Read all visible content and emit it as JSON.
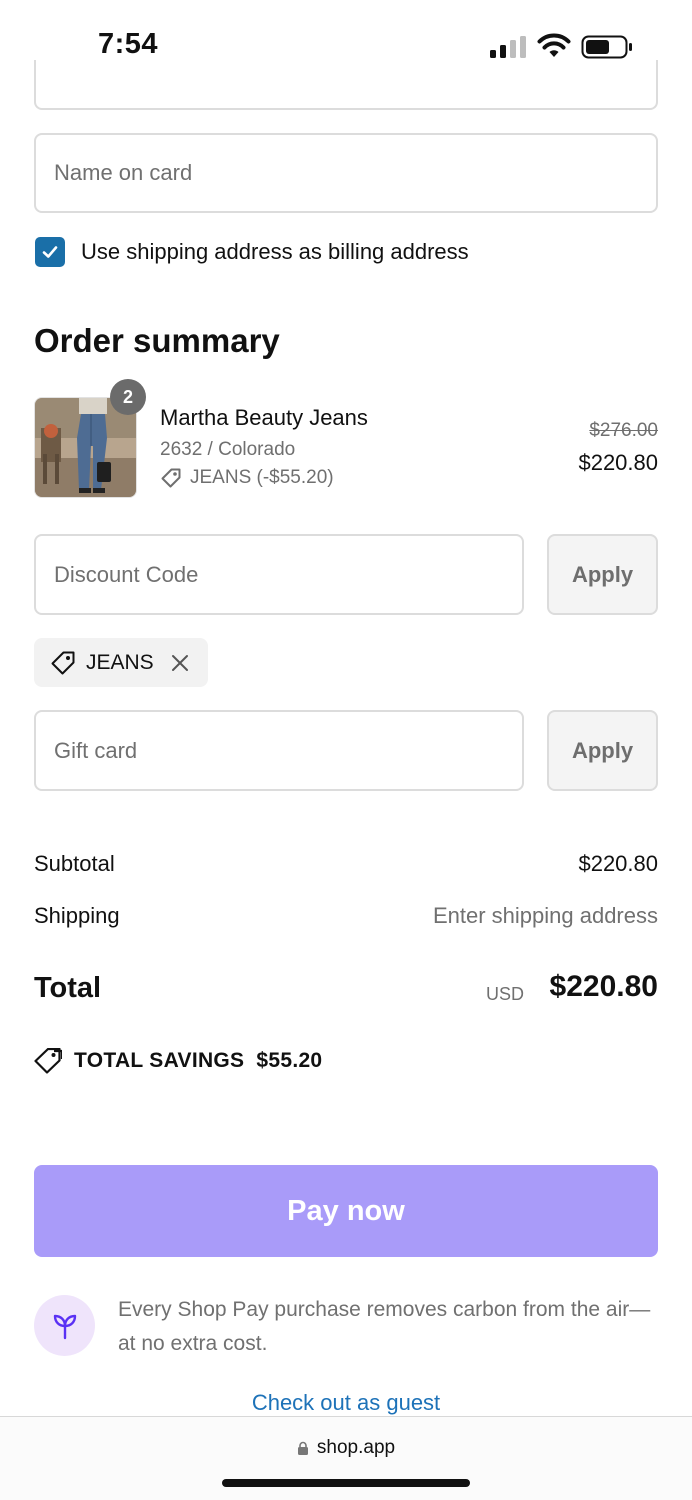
{
  "status_bar": {
    "time": "7:54"
  },
  "payment": {
    "name_on_card_placeholder": "Name on card",
    "billing_checkbox_label": "Use shipping address as billing address",
    "billing_checked": true
  },
  "order_summary": {
    "title": "Order summary",
    "item": {
      "quantity": "2",
      "name": "Martha Beauty Jeans",
      "variant": "2632 / Colorado",
      "discount_label": "JEANS (-$55.20)",
      "original_price": "$276.00",
      "price": "$220.80"
    },
    "discount_code": {
      "placeholder": "Discount Code",
      "apply_label": "Apply"
    },
    "applied_code": "JEANS",
    "gift_card": {
      "placeholder": "Gift card",
      "apply_label": "Apply"
    },
    "subtotal_label": "Subtotal",
    "subtotal_value": "$220.80",
    "shipping_label": "Shipping",
    "shipping_value": "Enter shipping address",
    "total_label": "Total",
    "currency": "USD",
    "total_value": "$220.80",
    "savings_label": "TOTAL SAVINGS",
    "savings_value": "$55.20"
  },
  "pay_now_label": "Pay now",
  "carbon_note": "Every Shop Pay purchase removes carbon from the air—at no extra cost.",
  "guest_link": "Check out as guest",
  "browser": {
    "url": "shop.app"
  },
  "colors": {
    "accent_checkbox": "#1a6fa8",
    "pay_button": "#a99bf9",
    "link": "#1d72b8",
    "leaf_bg": "#efe4fb"
  }
}
